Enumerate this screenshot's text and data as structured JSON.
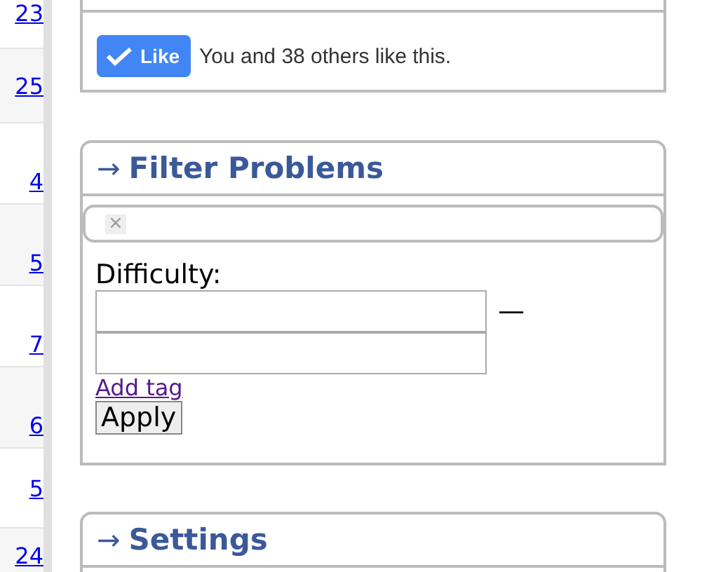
{
  "problem_links": [
    {
      "text": "23"
    },
    {
      "text": "25"
    },
    {
      "text": "4"
    },
    {
      "text": "5"
    },
    {
      "text": "7"
    },
    {
      "text": "6"
    },
    {
      "text": "5"
    },
    {
      "text": "24"
    }
  ],
  "like_panel": {
    "button": "Like",
    "liked": true,
    "text": "You and 38 others like this."
  },
  "filter_panel": {
    "arrow": "→",
    "title": "Filter Problems",
    "tag_remove": "×",
    "difficulty_label": "Difficulty:",
    "range_dash": "—",
    "add_tag": "Add tag",
    "apply": "Apply"
  },
  "settings_panel": {
    "arrow": "→",
    "title": "Settings"
  }
}
